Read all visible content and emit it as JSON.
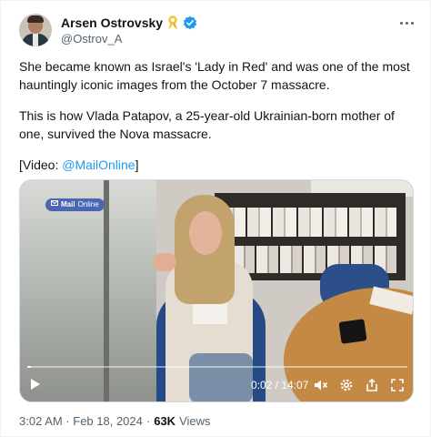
{
  "tweet": {
    "author": {
      "name": "Arsen Ostrovsky",
      "handle": "@Ostrov_A"
    },
    "text": {
      "p1": "She became known as Israel's 'Lady in Red' and was one of the most hauntingly iconic images from the October 7 massacre.",
      "p2": "This is how Vlada Patapov, a 25-year-old Ukrainian-born mother of one, survived the Nova massacre.",
      "p3_prefix": "[Video: ",
      "p3_link": "@MailOnline",
      "p3_suffix": "]"
    },
    "video": {
      "badge": "Mail",
      "badge_suffix": "Online",
      "time": "0:02 / 14:07",
      "progress": 0.0024
    },
    "footer": {
      "timestamp": "3:02 AM · Feb 18, 2024",
      "dot": "·",
      "views_count": "63K",
      "views_label": "Views"
    },
    "icons": {
      "ribbon": "ribbon-icon",
      "verified": "verified-icon",
      "more": "more-icon",
      "play": "play-icon",
      "mute": "volume-mute-icon",
      "settings": "gear-icon",
      "share": "share-icon",
      "fullscreen": "fullscreen-icon"
    },
    "colors": {
      "accent": "#1d9bf0",
      "ribbon": "#f4c430"
    }
  }
}
